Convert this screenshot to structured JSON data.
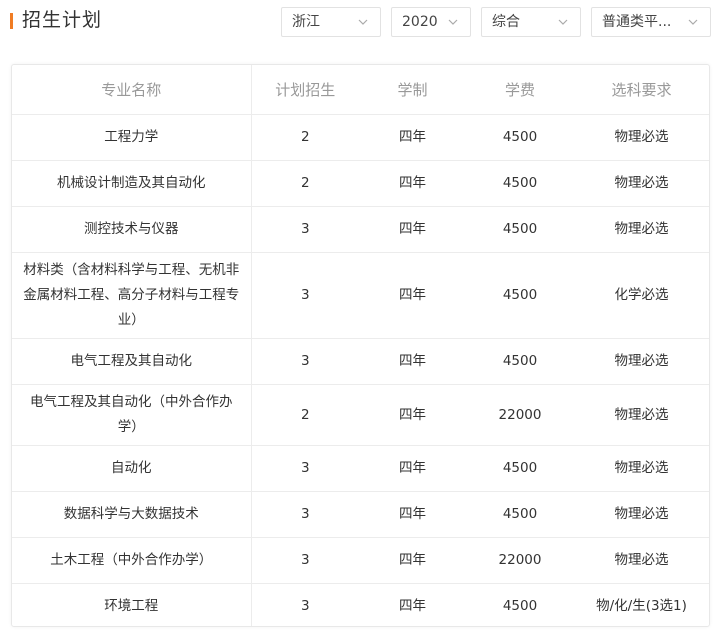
{
  "header": {
    "title": "招生计划",
    "filters": {
      "province": "浙江",
      "year": "2020",
      "type": "综合",
      "batch": "普通类平..."
    }
  },
  "colors": {
    "accent": "#f07c24",
    "header_text": "#999999",
    "body_text": "#333333"
  },
  "icons": {
    "dropdown": "chevron-down-icon"
  },
  "table": {
    "columns": [
      "专业名称",
      "计划招生",
      "学制",
      "学费",
      "选科要求"
    ],
    "rows": [
      {
        "major": "工程力学",
        "plan": "2",
        "duration": "四年",
        "fee": "4500",
        "subjects": "物理必选"
      },
      {
        "major": "机械设计制造及其自动化",
        "plan": "2",
        "duration": "四年",
        "fee": "4500",
        "subjects": "物理必选"
      },
      {
        "major": "测控技术与仪器",
        "plan": "3",
        "duration": "四年",
        "fee": "4500",
        "subjects": "物理必选"
      },
      {
        "major": "材料类（含材料科学与工程、无机非金属材料工程、高分子材料与工程专业）",
        "plan": "3",
        "duration": "四年",
        "fee": "4500",
        "subjects": "化学必选"
      },
      {
        "major": "电气工程及其自动化",
        "plan": "3",
        "duration": "四年",
        "fee": "4500",
        "subjects": "物理必选"
      },
      {
        "major": "电气工程及其自动化（中外合作办学）",
        "plan": "2",
        "duration": "四年",
        "fee": "22000",
        "subjects": "物理必选"
      },
      {
        "major": "自动化",
        "plan": "3",
        "duration": "四年",
        "fee": "4500",
        "subjects": "物理必选"
      },
      {
        "major": "数据科学与大数据技术",
        "plan": "3",
        "duration": "四年",
        "fee": "4500",
        "subjects": "物理必选"
      },
      {
        "major": "土木工程（中外合作办学）",
        "plan": "3",
        "duration": "四年",
        "fee": "22000",
        "subjects": "物理必选"
      },
      {
        "major": "环境工程",
        "plan": "3",
        "duration": "四年",
        "fee": "4500",
        "subjects": "物/化/生(3选1)"
      }
    ]
  }
}
